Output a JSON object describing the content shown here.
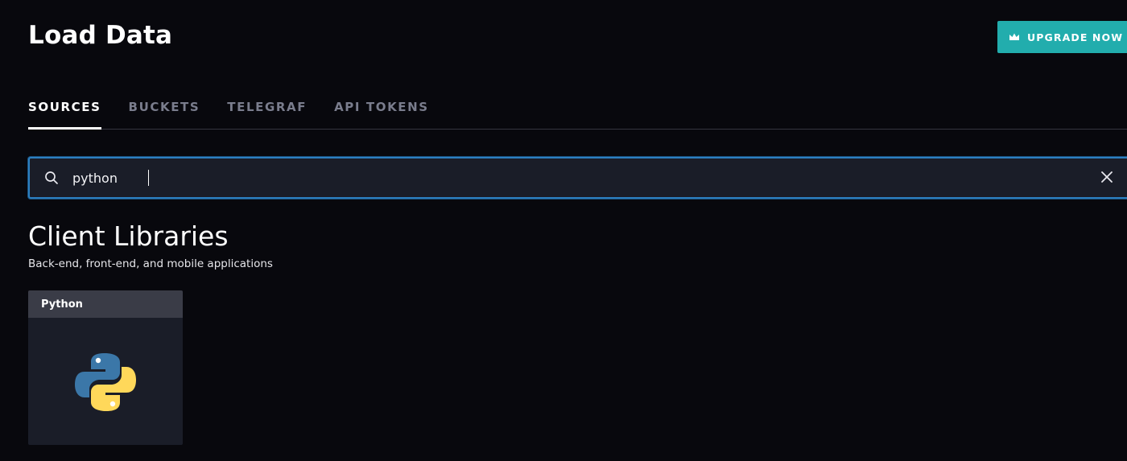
{
  "header": {
    "title": "Load Data",
    "upgrade_label": "UPGRADE NOW"
  },
  "tabs": [
    {
      "label": "SOURCES",
      "active": true
    },
    {
      "label": "BUCKETS",
      "active": false
    },
    {
      "label": "TELEGRAF",
      "active": false
    },
    {
      "label": "API TOKENS",
      "active": false
    }
  ],
  "search": {
    "value": "python",
    "icon": "search-icon",
    "clear_icon": "close-icon"
  },
  "section": {
    "title": "Client Libraries",
    "subtitle": "Back-end, front-end, and mobile applications"
  },
  "cards": [
    {
      "label": "Python",
      "icon": "python-logo-icon"
    }
  ],
  "colors": {
    "background": "#08080d",
    "accent": "#22adad",
    "focus": "#2c7fc0",
    "card": "#1a1d28",
    "card_header": "#3a3c47"
  }
}
